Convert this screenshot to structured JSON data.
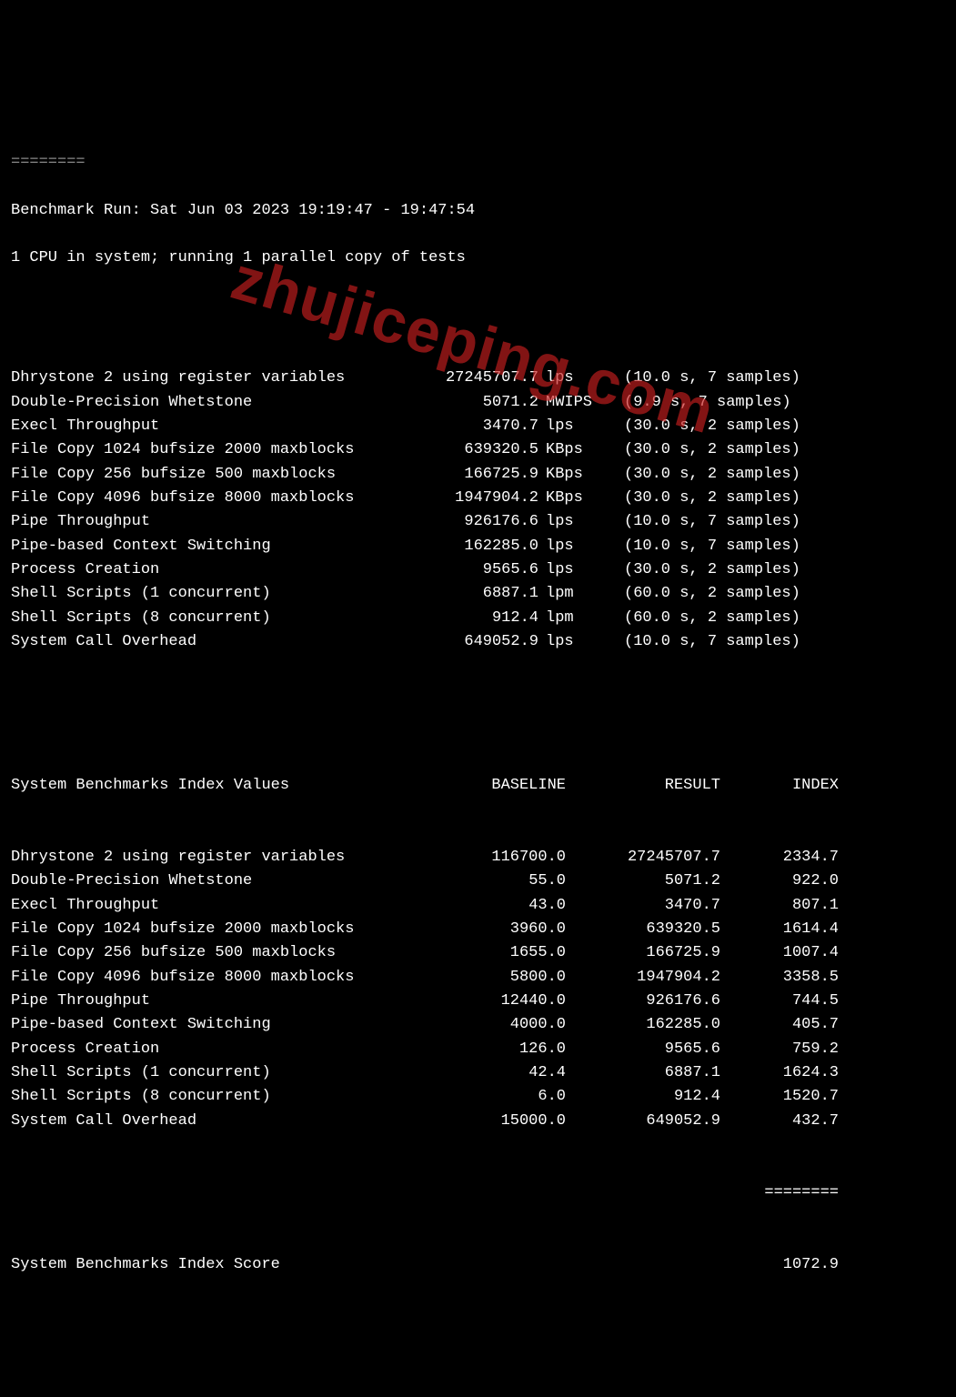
{
  "watermark": "zhujiceping.com",
  "header": {
    "top_sep": "========",
    "run_line": "Benchmark Run: Sat Jun 03 2023 19:19:47 - 19:47:54",
    "cpu_line": "1 CPU in system; running 1 parallel copy of tests"
  },
  "tests": [
    {
      "name": "Dhrystone 2 using register variables",
      "value": "27245707.7",
      "unit": "lps",
      "note": "(10.0 s, 7 samples)"
    },
    {
      "name": "Double-Precision Whetstone",
      "value": "5071.2",
      "unit": "MWIPS",
      "note": "(9.9 s, 7 samples)"
    },
    {
      "name": "Execl Throughput",
      "value": "3470.7",
      "unit": "lps",
      "note": "(30.0 s, 2 samples)"
    },
    {
      "name": "File Copy 1024 bufsize 2000 maxblocks",
      "value": "639320.5",
      "unit": "KBps",
      "note": "(30.0 s, 2 samples)"
    },
    {
      "name": "File Copy 256 bufsize 500 maxblocks",
      "value": "166725.9",
      "unit": "KBps",
      "note": "(30.0 s, 2 samples)"
    },
    {
      "name": "File Copy 4096 bufsize 8000 maxblocks",
      "value": "1947904.2",
      "unit": "KBps",
      "note": "(30.0 s, 2 samples)"
    },
    {
      "name": "Pipe Throughput",
      "value": "926176.6",
      "unit": "lps",
      "note": "(10.0 s, 7 samples)"
    },
    {
      "name": "Pipe-based Context Switching",
      "value": "162285.0",
      "unit": "lps",
      "note": "(10.0 s, 7 samples)"
    },
    {
      "name": "Process Creation",
      "value": "9565.6",
      "unit": "lps",
      "note": "(30.0 s, 2 samples)"
    },
    {
      "name": "Shell Scripts (1 concurrent)",
      "value": "6887.1",
      "unit": "lpm",
      "note": "(60.0 s, 2 samples)"
    },
    {
      "name": "Shell Scripts (8 concurrent)",
      "value": "912.4",
      "unit": "lpm",
      "note": "(60.0 s, 2 samples)"
    },
    {
      "name": "System Call Overhead",
      "value": "649052.9",
      "unit": "lps",
      "note": "(10.0 s, 7 samples)"
    }
  ],
  "index_header": {
    "title": "System Benchmarks Index Values",
    "baseline": "BASELINE",
    "result": "RESULT",
    "index": "INDEX"
  },
  "index_rows": [
    {
      "name": "Dhrystone 2 using register variables",
      "baseline": "116700.0",
      "result": "27245707.7",
      "index": "2334.7"
    },
    {
      "name": "Double-Precision Whetstone",
      "baseline": "55.0",
      "result": "5071.2",
      "index": "922.0"
    },
    {
      "name": "Execl Throughput",
      "baseline": "43.0",
      "result": "3470.7",
      "index": "807.1"
    },
    {
      "name": "File Copy 1024 bufsize 2000 maxblocks",
      "baseline": "3960.0",
      "result": "639320.5",
      "index": "1614.4"
    },
    {
      "name": "File Copy 256 bufsize 500 maxblocks",
      "baseline": "1655.0",
      "result": "166725.9",
      "index": "1007.4"
    },
    {
      "name": "File Copy 4096 bufsize 8000 maxblocks",
      "baseline": "5800.0",
      "result": "1947904.2",
      "index": "3358.5"
    },
    {
      "name": "Pipe Throughput",
      "baseline": "12440.0",
      "result": "926176.6",
      "index": "744.5"
    },
    {
      "name": "Pipe-based Context Switching",
      "baseline": "4000.0",
      "result": "162285.0",
      "index": "405.7"
    },
    {
      "name": "Process Creation",
      "baseline": "126.0",
      "result": "9565.6",
      "index": "759.2"
    },
    {
      "name": "Shell Scripts (1 concurrent)",
      "baseline": "42.4",
      "result": "6887.1",
      "index": "1624.3"
    },
    {
      "name": "Shell Scripts (8 concurrent)",
      "baseline": "6.0",
      "result": "912.4",
      "index": "1520.7"
    },
    {
      "name": "System Call Overhead",
      "baseline": "15000.0",
      "result": "649052.9",
      "index": "432.7"
    }
  ],
  "separator": "========",
  "final_score": {
    "label": "System Benchmarks Index Score",
    "value": "1072.9"
  }
}
